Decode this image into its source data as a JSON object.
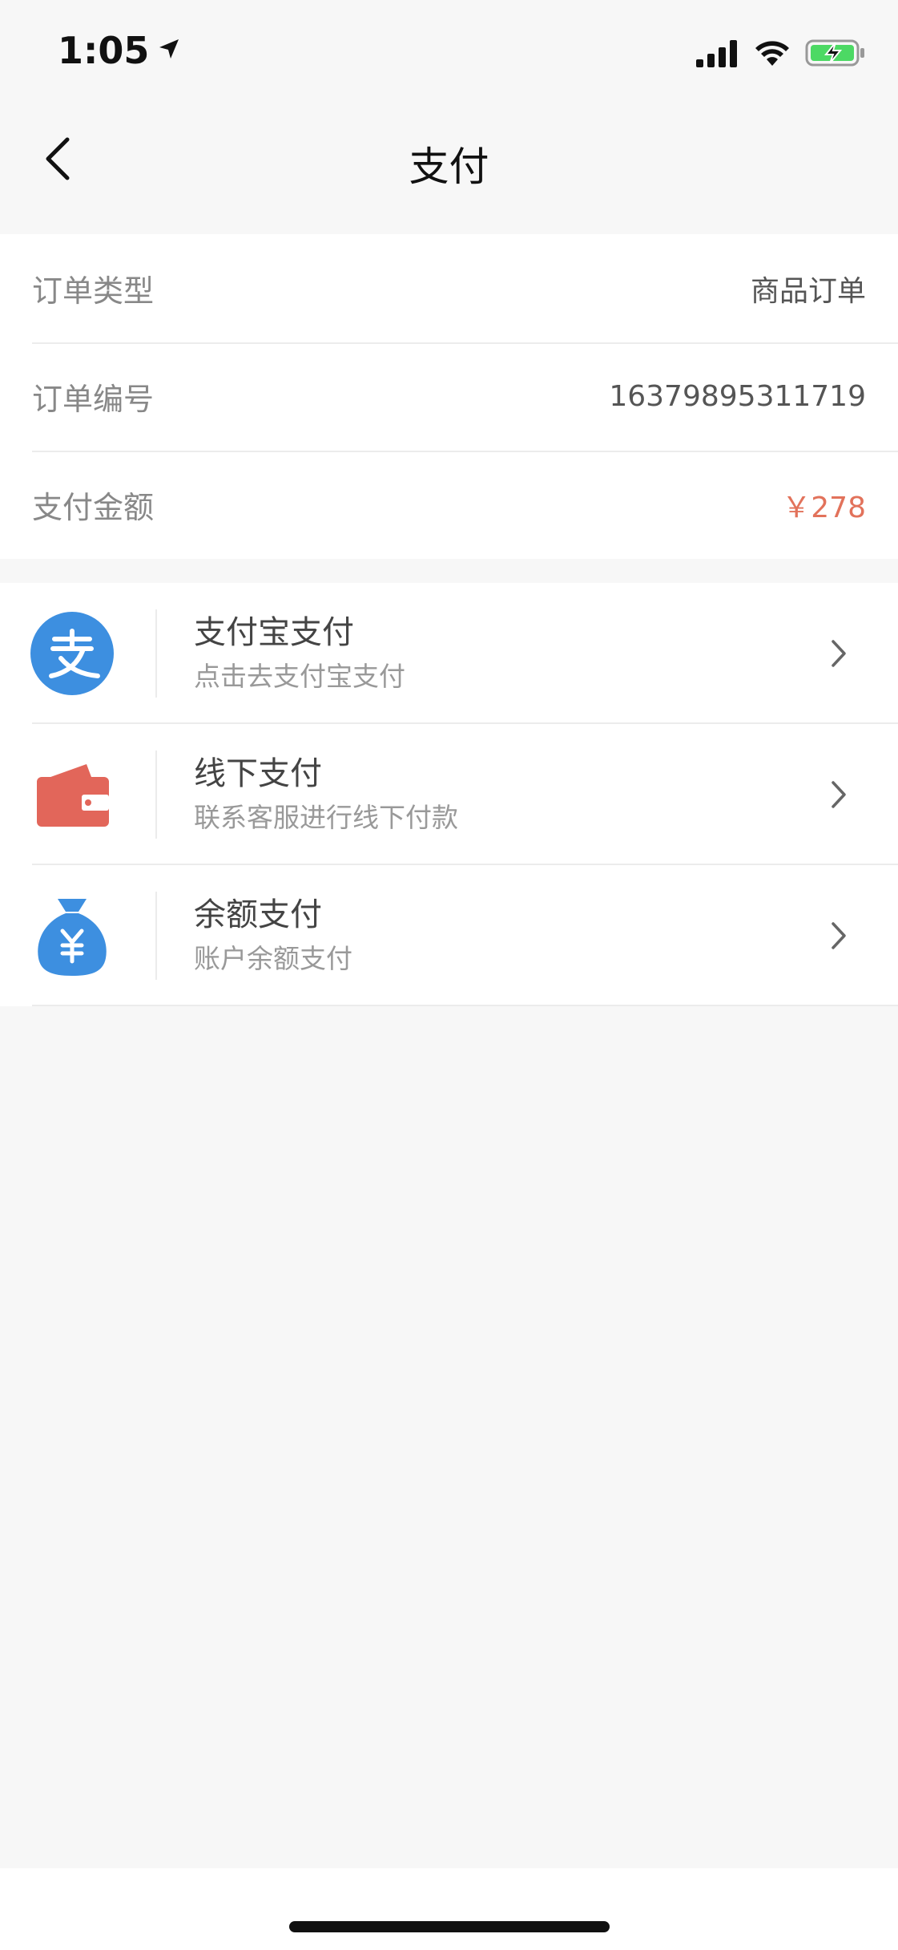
{
  "status_bar": {
    "time": "1:05",
    "icons": [
      "location-arrow-icon",
      "signal-bars-icon",
      "wifi-icon",
      "battery-charging-icon"
    ],
    "battery_color": "#4cd964"
  },
  "nav": {
    "title": "支付",
    "back_icon": "chevron-left-icon"
  },
  "order_info": {
    "rows": [
      {
        "label": "订单类型",
        "value": "商品订单"
      },
      {
        "label": "订单编号",
        "value": "16379895311719"
      },
      {
        "label": "支付金额",
        "value": "￥278"
      }
    ],
    "amount_color": "#e2725b"
  },
  "payment_methods": [
    {
      "title": "支付宝支付",
      "subtitle": "点击去支付宝支付",
      "icon": "alipay-icon",
      "icon_color": "#3d8fe0"
    },
    {
      "title": "线下支付",
      "subtitle": "联系客服进行线下付款",
      "icon": "wallet-icon",
      "icon_color": "#e2665a"
    },
    {
      "title": "余额支付",
      "subtitle": "账户余额支付",
      "icon": "money-bag-icon",
      "icon_color": "#3d8fe0"
    }
  ]
}
